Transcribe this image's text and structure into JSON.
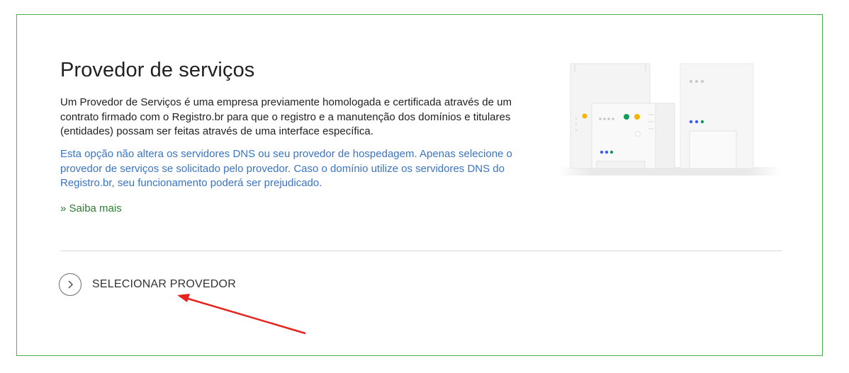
{
  "section": {
    "title": "Provedor de serviços",
    "description": "Um Provedor de Serviços é uma empresa previamente homologada e certificada através de um contrato firmado com o Registro.br para que o registro e a manutenção dos domínios e titulares (entidades) possam ser feitas através de uma interface específica.",
    "note": "Esta opção não altera os servidores DNS ou seu provedor de hospedagem. Apenas selecione o provedor de serviços se solicitado pelo provedor. Caso o domínio utilize os servidores DNS do Registro.br, seu funcionamento poderá ser prejudicado.",
    "more_link": "» Saiba mais"
  },
  "action": {
    "select_label": "SELECIONAR PROVEDOR"
  },
  "colors": {
    "border": "#4caf50",
    "note_text": "#3a74c4",
    "link": "#2e7d32",
    "annotation_arrow": "#e8231f"
  },
  "icons": {
    "select_icon": "chevron-right-circle-icon",
    "illustration": "servers-illustration",
    "annotation": "red-arrow-annotation"
  }
}
